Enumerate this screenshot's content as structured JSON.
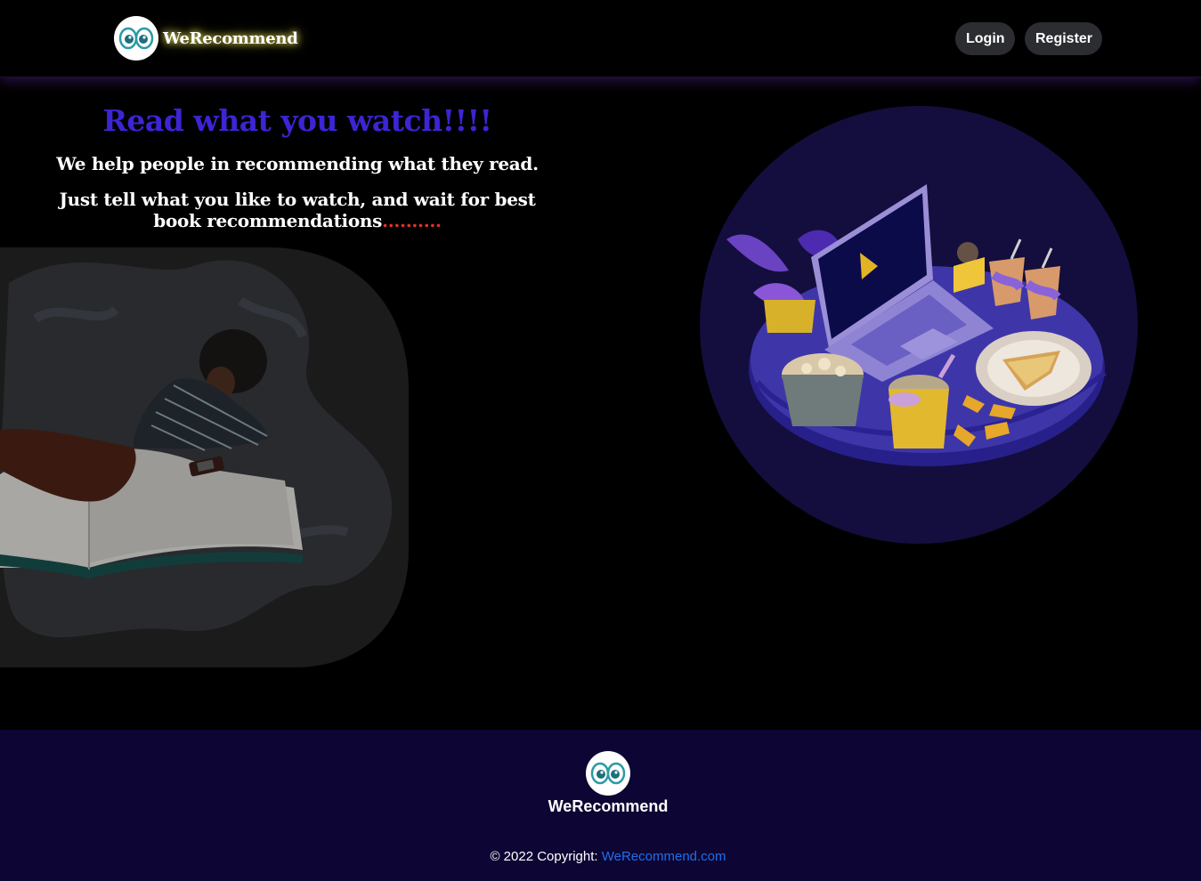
{
  "navbar": {
    "brand_name": "WeRecommend",
    "login_label": "Login",
    "register_label": "Register"
  },
  "hero": {
    "title": "Read what you watch!!!!",
    "subtitle_1": "We help people in recommending what they read.",
    "subtitle_2": "Just tell what you like to watch, and wait for best book recommendations",
    "subtitle_2_dots": ".........."
  },
  "illustrations": {
    "left": "woman-reading-book-illustration",
    "right": "laptop-snacks-table-illustration"
  },
  "footer": {
    "brand_name": "WeRecommend",
    "copyright_prefix": "© 2022 Copyright: ",
    "copyright_link": "WeRecommend.com"
  },
  "colors": {
    "background": "#000000",
    "title_accent": "#3b25d4",
    "footer_bg": "#0d0533",
    "link": "#1f6feb",
    "button_bg": "#2b2d31",
    "dots": "#e0332a"
  }
}
